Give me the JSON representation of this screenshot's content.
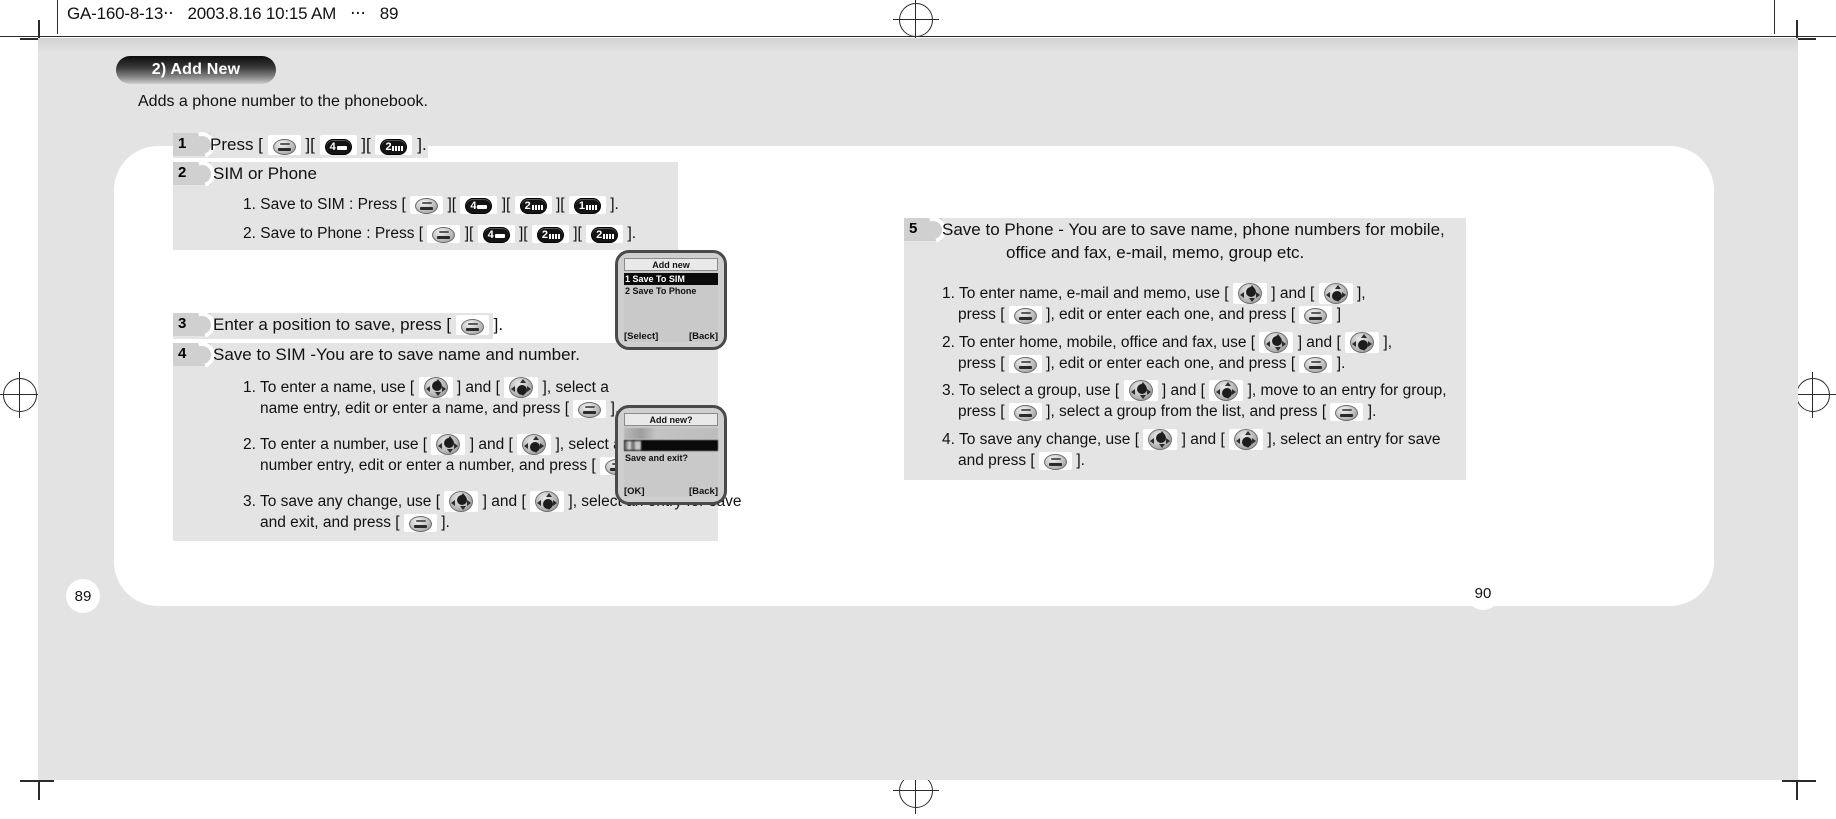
{
  "header": {
    "doc_code": "GA-160-8-13",
    "cjk_1": "··",
    "date": "2003.8.16 10:15 AM",
    "cjk_2": "···",
    "page": "89"
  },
  "section": {
    "title": "2) Add New",
    "intro": "Adds a phone number to the phonebook."
  },
  "left_column": {
    "step1": {
      "num": "1",
      "text_a": "Press [",
      "text_b": "][",
      "text_c": "][",
      "text_d": "]."
    },
    "step2": {
      "num": "2",
      "heading": "SIM or Phone",
      "item1": {
        "label": "1. Save to SIM : Press [",
        "sep": "][",
        "end": "]."
      },
      "item2": {
        "label": "2. Save to Phone : Press [",
        "sep": "][",
        "end": "]."
      }
    },
    "step3": {
      "num": "3",
      "text_a": "Enter a position to save, press [",
      "text_b": "]."
    },
    "step4": {
      "num": "4",
      "heading": "Save to SIM -You are to save name and number.",
      "items": [
        {
          "a": "1. To enter a name, use [",
          "b": "] and [",
          "c": "], select a",
          "d": "name entry, edit or enter a name, and press [",
          "e": "]."
        },
        {
          "a": "2. To enter a number, use [",
          "b": "] and [",
          "c": "], select a",
          "d": "number entry, edit or enter a number, and press [",
          "e": "]."
        },
        {
          "a": "3. To save any change, use [",
          "b": "] and [",
          "c": "], select an entry for save",
          "d": "and exit, and press [",
          "e": "]."
        }
      ]
    }
  },
  "right_column": {
    "step5": {
      "num": "5",
      "heading_line1": "Save to Phone - You are to save name, phone numbers for mobile,",
      "heading_line2": "office and fax, e-mail, memo, group etc.",
      "items": [
        {
          "a": "1. To enter name, e-mail and memo, use [",
          "b": "] and [",
          "c": "],",
          "d": "press [",
          "e": "], edit or enter each one, and press [",
          "f": "]"
        },
        {
          "a": "2. To enter  home, mobile, office and fax, use [",
          "b": "] and [",
          "c": "],",
          "d": "press [",
          "e": "], edit or enter each one, and press [",
          "f": "]."
        },
        {
          "a": "3. To select a group, use [",
          "b": "] and [",
          "c": "], move to an entry for group,",
          "d": "press [",
          "e": "], select a group from the list, and press [",
          "f": "]."
        },
        {
          "a": "4. To save any change, use [",
          "b": "] and [",
          "c": "], select an entry for save",
          "d": "and press [",
          "e": "].",
          "f": ""
        }
      ]
    }
  },
  "phone_screen_1": {
    "title": "Add new",
    "row1": "1 Save To SIM",
    "row2": "2 Save To Phone",
    "softkey_left": "[Select]",
    "softkey_right": "[Back]"
  },
  "phone_screen_2": {
    "title": "Add new?",
    "prompt": "Save and exit?",
    "softkey_left": "[OK]",
    "softkey_right": "[Back]"
  },
  "keys": {
    "ok": "ok-key",
    "num4": "4",
    "num2": "2",
    "num1": "1",
    "nav_up": "nav-up-key",
    "nav_down": "nav-down-key"
  },
  "page_numbers": {
    "left": "89",
    "right": "90"
  }
}
